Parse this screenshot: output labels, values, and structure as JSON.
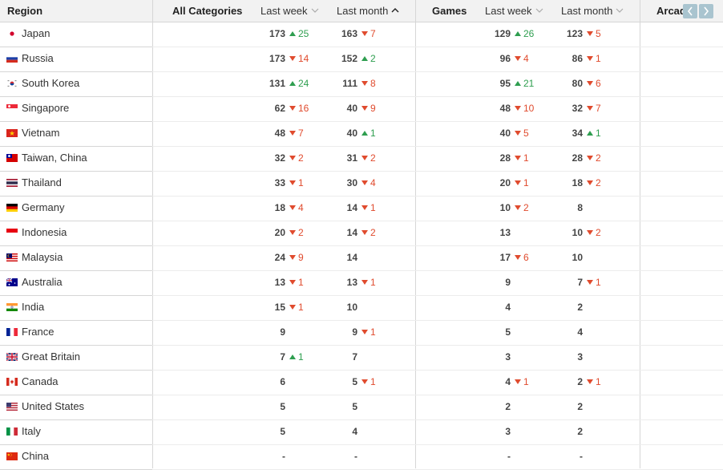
{
  "header": {
    "region": "Region",
    "groups": [
      {
        "title": "All Categories",
        "last_week": "Last week",
        "last_month": "Last month",
        "sorted": "last_month"
      },
      {
        "title": "Games",
        "last_week": "Last week",
        "last_month": "Last month",
        "sorted": null
      },
      {
        "title": "Arcade",
        "last_week": "",
        "last_month": "",
        "sorted": null
      }
    ],
    "prev_icon": "chevron-left-icon",
    "next_icon": "chevron-right-icon"
  },
  "colors": {
    "up": "#2e9e4f",
    "down": "#e04b2e",
    "header_bg": "#f2f2f2",
    "nav_btn": "#a9c4cf"
  },
  "rows": [
    {
      "region": "Japan",
      "flag": "jp",
      "all_week": "173",
      "all_week_chg": "25",
      "all_week_dir": "up",
      "all_month": "163",
      "all_month_chg": "7",
      "all_month_dir": "down",
      "games_week": "129",
      "games_week_chg": "26",
      "games_week_dir": "up",
      "games_month": "123",
      "games_month_chg": "5",
      "games_month_dir": "down"
    },
    {
      "region": "Russia",
      "flag": "ru",
      "all_week": "173",
      "all_week_chg": "14",
      "all_week_dir": "down",
      "all_month": "152",
      "all_month_chg": "2",
      "all_month_dir": "up",
      "games_week": "96",
      "games_week_chg": "4",
      "games_week_dir": "down",
      "games_month": "86",
      "games_month_chg": "1",
      "games_month_dir": "down"
    },
    {
      "region": "South Korea",
      "flag": "kr",
      "all_week": "131",
      "all_week_chg": "24",
      "all_week_dir": "up",
      "all_month": "111",
      "all_month_chg": "8",
      "all_month_dir": "down",
      "games_week": "95",
      "games_week_chg": "21",
      "games_week_dir": "up",
      "games_month": "80",
      "games_month_chg": "6",
      "games_month_dir": "down"
    },
    {
      "region": "Singapore",
      "flag": "sg",
      "all_week": "62",
      "all_week_chg": "16",
      "all_week_dir": "down",
      "all_month": "40",
      "all_month_chg": "9",
      "all_month_dir": "down",
      "games_week": "48",
      "games_week_chg": "10",
      "games_week_dir": "down",
      "games_month": "32",
      "games_month_chg": "7",
      "games_month_dir": "down"
    },
    {
      "region": "Vietnam",
      "flag": "vn",
      "all_week": "48",
      "all_week_chg": "7",
      "all_week_dir": "down",
      "all_month": "40",
      "all_month_chg": "1",
      "all_month_dir": "up",
      "games_week": "40",
      "games_week_chg": "5",
      "games_week_dir": "down",
      "games_month": "34",
      "games_month_chg": "1",
      "games_month_dir": "up"
    },
    {
      "region": "Taiwan, China",
      "flag": "tw",
      "all_week": "32",
      "all_week_chg": "2",
      "all_week_dir": "down",
      "all_month": "31",
      "all_month_chg": "2",
      "all_month_dir": "down",
      "games_week": "28",
      "games_week_chg": "1",
      "games_week_dir": "down",
      "games_month": "28",
      "games_month_chg": "2",
      "games_month_dir": "down"
    },
    {
      "region": "Thailand",
      "flag": "th",
      "all_week": "33",
      "all_week_chg": "1",
      "all_week_dir": "down",
      "all_month": "30",
      "all_month_chg": "4",
      "all_month_dir": "down",
      "games_week": "20",
      "games_week_chg": "1",
      "games_week_dir": "down",
      "games_month": "18",
      "games_month_chg": "2",
      "games_month_dir": "down"
    },
    {
      "region": "Germany",
      "flag": "de",
      "all_week": "18",
      "all_week_chg": "4",
      "all_week_dir": "down",
      "all_month": "14",
      "all_month_chg": "1",
      "all_month_dir": "down",
      "games_week": "10",
      "games_week_chg": "2",
      "games_week_dir": "down",
      "games_month": "8",
      "games_month_chg": "",
      "games_month_dir": ""
    },
    {
      "region": "Indonesia",
      "flag": "id",
      "all_week": "20",
      "all_week_chg": "2",
      "all_week_dir": "down",
      "all_month": "14",
      "all_month_chg": "2",
      "all_month_dir": "down",
      "games_week": "13",
      "games_week_chg": "",
      "games_week_dir": "",
      "games_month": "10",
      "games_month_chg": "2",
      "games_month_dir": "down"
    },
    {
      "region": "Malaysia",
      "flag": "my",
      "all_week": "24",
      "all_week_chg": "9",
      "all_week_dir": "down",
      "all_month": "14",
      "all_month_chg": "",
      "all_month_dir": "",
      "games_week": "17",
      "games_week_chg": "6",
      "games_week_dir": "down",
      "games_month": "10",
      "games_month_chg": "",
      "games_month_dir": ""
    },
    {
      "region": "Australia",
      "flag": "au",
      "all_week": "13",
      "all_week_chg": "1",
      "all_week_dir": "down",
      "all_month": "13",
      "all_month_chg": "1",
      "all_month_dir": "down",
      "games_week": "9",
      "games_week_chg": "",
      "games_week_dir": "",
      "games_month": "7",
      "games_month_chg": "1",
      "games_month_dir": "down"
    },
    {
      "region": "India",
      "flag": "in",
      "all_week": "15",
      "all_week_chg": "1",
      "all_week_dir": "down",
      "all_month": "10",
      "all_month_chg": "",
      "all_month_dir": "",
      "games_week": "4",
      "games_week_chg": "",
      "games_week_dir": "",
      "games_month": "2",
      "games_month_chg": "",
      "games_month_dir": ""
    },
    {
      "region": "France",
      "flag": "fr",
      "all_week": "9",
      "all_week_chg": "",
      "all_week_dir": "",
      "all_month": "9",
      "all_month_chg": "1",
      "all_month_dir": "down",
      "games_week": "5",
      "games_week_chg": "",
      "games_week_dir": "",
      "games_month": "4",
      "games_month_chg": "",
      "games_month_dir": ""
    },
    {
      "region": "Great Britain",
      "flag": "gb",
      "all_week": "7",
      "all_week_chg": "1",
      "all_week_dir": "up",
      "all_month": "7",
      "all_month_chg": "",
      "all_month_dir": "",
      "games_week": "3",
      "games_week_chg": "",
      "games_week_dir": "",
      "games_month": "3",
      "games_month_chg": "",
      "games_month_dir": ""
    },
    {
      "region": "Canada",
      "flag": "ca",
      "all_week": "6",
      "all_week_chg": "",
      "all_week_dir": "",
      "all_month": "5",
      "all_month_chg": "1",
      "all_month_dir": "down",
      "games_week": "4",
      "games_week_chg": "1",
      "games_week_dir": "down",
      "games_month": "2",
      "games_month_chg": "1",
      "games_month_dir": "down"
    },
    {
      "region": "United States",
      "flag": "us",
      "all_week": "5",
      "all_week_chg": "",
      "all_week_dir": "",
      "all_month": "5",
      "all_month_chg": "",
      "all_month_dir": "",
      "games_week": "2",
      "games_week_chg": "",
      "games_week_dir": "",
      "games_month": "2",
      "games_month_chg": "",
      "games_month_dir": ""
    },
    {
      "region": "Italy",
      "flag": "it",
      "all_week": "5",
      "all_week_chg": "",
      "all_week_dir": "",
      "all_month": "4",
      "all_month_chg": "",
      "all_month_dir": "",
      "games_week": "3",
      "games_week_chg": "",
      "games_week_dir": "",
      "games_month": "2",
      "games_month_chg": "",
      "games_month_dir": ""
    },
    {
      "region": "China",
      "flag": "cn",
      "all_week": "-",
      "all_week_chg": "",
      "all_week_dir": "",
      "all_month": "-",
      "all_month_chg": "",
      "all_month_dir": "",
      "games_week": "-",
      "games_week_chg": "",
      "games_week_dir": "",
      "games_month": "-",
      "games_month_chg": "",
      "games_month_dir": ""
    }
  ]
}
